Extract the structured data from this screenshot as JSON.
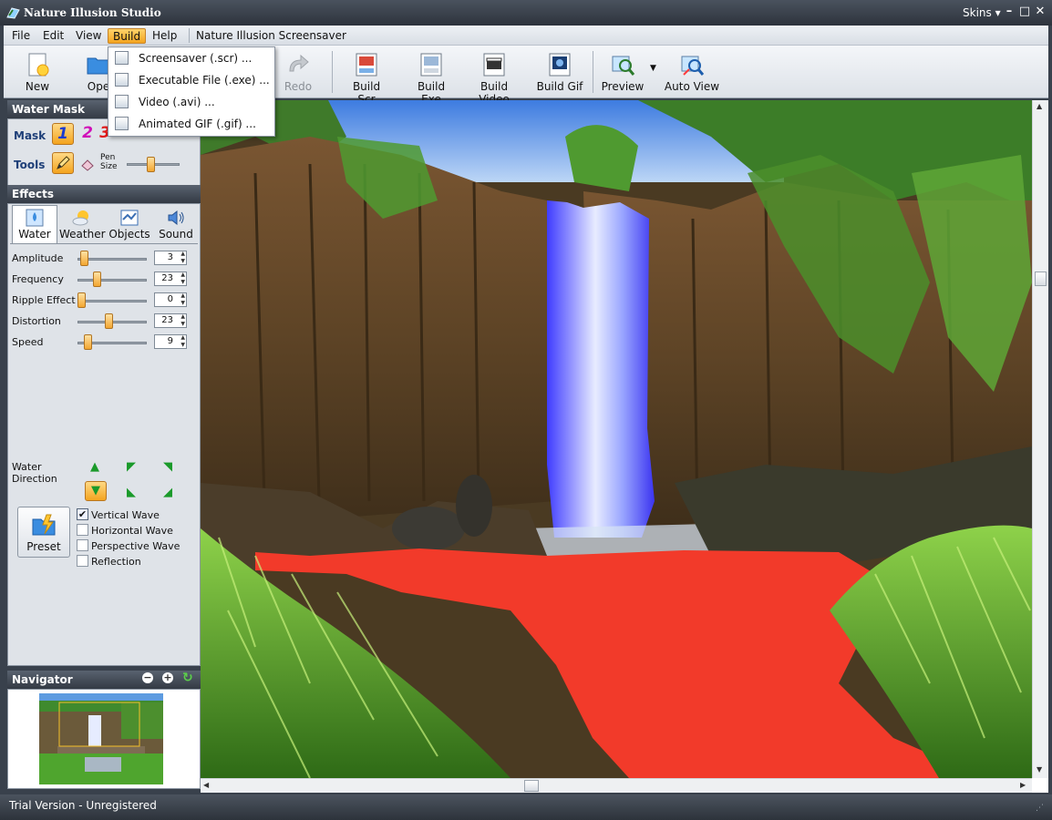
{
  "window": {
    "title": "Nature Illusion Studio",
    "skins_label": "Skins"
  },
  "menu": {
    "items": [
      "File",
      "Edit",
      "View",
      "Build",
      "Help"
    ],
    "extra": "Nature Illusion Screensaver",
    "active": "Build"
  },
  "toolbar": {
    "new": "New",
    "open": "Ope",
    "redo": "Redo",
    "build_scr": "Build Scr",
    "build_exe": "Build Exe",
    "build_video": "Build Video",
    "build_gif": "Build Gif",
    "preview": "Preview",
    "auto_view": "Auto View"
  },
  "build_menu": {
    "items": [
      "Screensaver (.scr) ...",
      "Executable File (.exe) ...",
      "Video (.avi) ...",
      "Animated GIF (.gif) ..."
    ]
  },
  "water_mask": {
    "title": "Water Mask",
    "mask_label": "Mask",
    "mask_numbers": [
      "1",
      "2",
      "3"
    ],
    "tools_label": "Tools",
    "pen_size_label": "Pen Size",
    "pen_size": 0.45
  },
  "effects": {
    "title": "Effects",
    "tabs": [
      "Water",
      "Weather",
      "Objects",
      "Sound"
    ],
    "sliders": [
      {
        "label": "Amplitude",
        "value": "3",
        "pos": 0.05
      },
      {
        "label": "Frequency",
        "value": "23",
        "pos": 0.25
      },
      {
        "label": "Ripple Effect",
        "value": "0",
        "pos": 0.0
      },
      {
        "label": "Distortion",
        "value": "23",
        "pos": 0.45
      },
      {
        "label": "Speed",
        "value": "9",
        "pos": 0.1
      }
    ],
    "water_direction_label": "Water Direction",
    "preset_label": "Preset",
    "checkboxes": [
      {
        "label": "Vertical Wave",
        "checked": true
      },
      {
        "label": "Horizontal Wave",
        "checked": false
      },
      {
        "label": "Perspective Wave",
        "checked": false
      },
      {
        "label": "Reflection",
        "checked": false
      }
    ]
  },
  "navigator": {
    "title": "Navigator"
  },
  "status": {
    "text": "Trial Version - Unregistered"
  },
  "colors": {
    "water_mask": "#f23a2a",
    "panel_header": "#333a44",
    "accent": "#f4a41f"
  }
}
